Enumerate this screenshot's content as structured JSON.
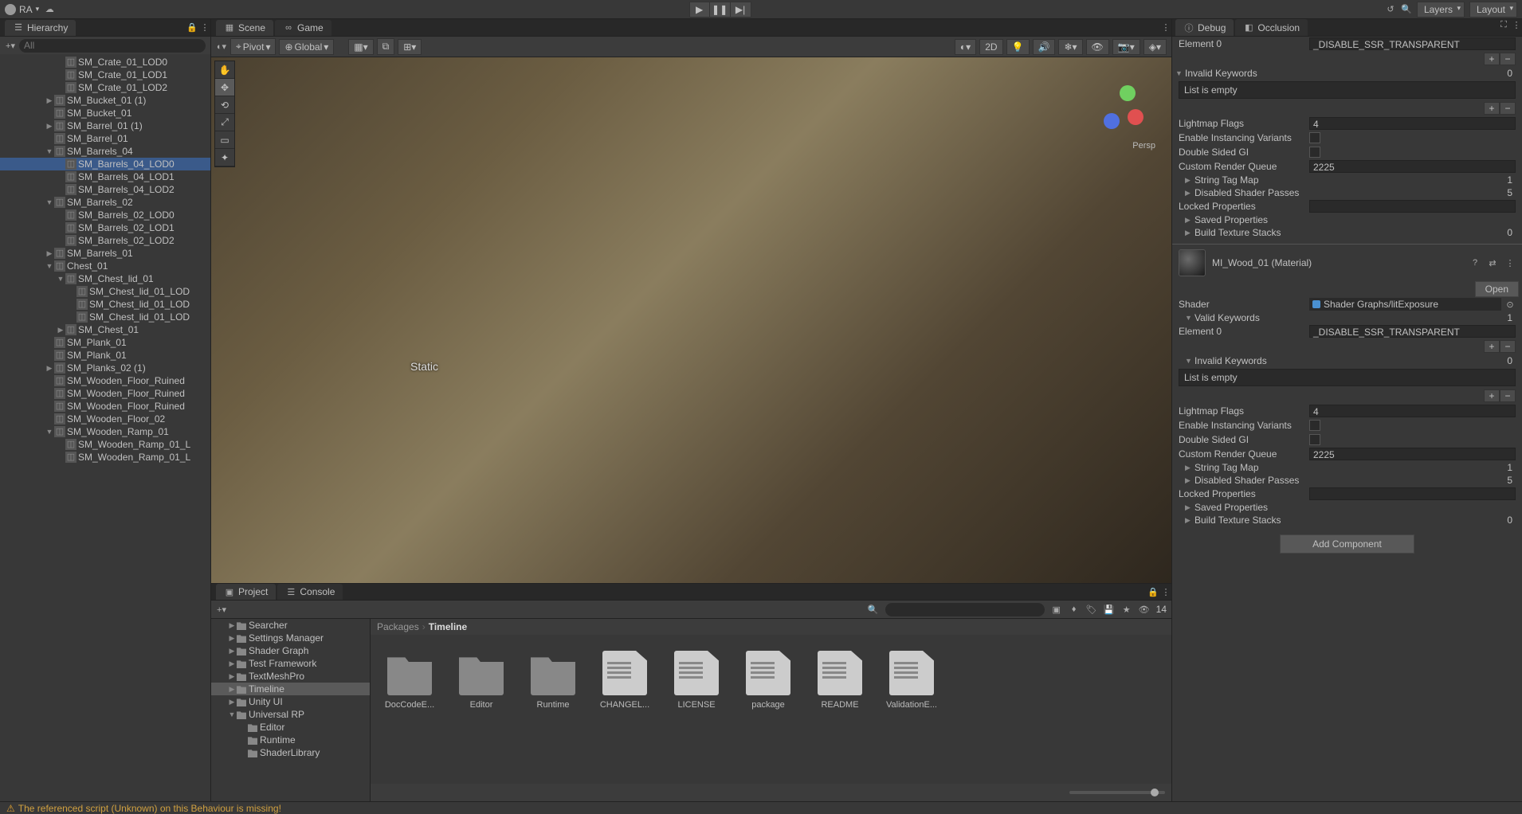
{
  "topbar": {
    "account": "RA",
    "layers": "Layers",
    "layout": "Layout"
  },
  "tabs": {
    "hierarchy": "Hierarchy",
    "scene": "Scene",
    "game": "Game",
    "project": "Project",
    "console": "Console",
    "debug": "Debug",
    "occlusion": "Occlusion"
  },
  "sceneToolbar": {
    "pivot": "Pivot",
    "global": "Global",
    "twoD": "2D"
  },
  "hierarchy": {
    "search_placeholder": "All",
    "items": [
      {
        "name": "SM_Crate_01_LOD0",
        "depth": 5
      },
      {
        "name": "SM_Crate_01_LOD1",
        "depth": 5
      },
      {
        "name": "SM_Crate_01_LOD2",
        "depth": 5
      },
      {
        "name": "SM_Bucket_01 (1)",
        "depth": 4,
        "exp": true
      },
      {
        "name": "SM_Bucket_01",
        "depth": 4
      },
      {
        "name": "SM_Barrel_01 (1)",
        "depth": 4,
        "exp": true
      },
      {
        "name": "SM_Barrel_01",
        "depth": 4
      },
      {
        "name": "SM_Barrels_04",
        "depth": 4,
        "open": true
      },
      {
        "name": "SM_Barrels_04_LOD0",
        "depth": 5,
        "sel": true
      },
      {
        "name": "SM_Barrels_04_LOD1",
        "depth": 5
      },
      {
        "name": "SM_Barrels_04_LOD2",
        "depth": 5
      },
      {
        "name": "SM_Barrels_02",
        "depth": 4,
        "open": true
      },
      {
        "name": "SM_Barrels_02_LOD0",
        "depth": 5
      },
      {
        "name": "SM_Barrels_02_LOD1",
        "depth": 5
      },
      {
        "name": "SM_Barrels_02_LOD2",
        "depth": 5
      },
      {
        "name": "SM_Barrels_01",
        "depth": 4,
        "exp": true
      },
      {
        "name": "Chest_01",
        "depth": 4,
        "open": true
      },
      {
        "name": "SM_Chest_lid_01",
        "depth": 5,
        "open": true
      },
      {
        "name": "SM_Chest_lid_01_LOD",
        "depth": 6
      },
      {
        "name": "SM_Chest_lid_01_LOD",
        "depth": 6
      },
      {
        "name": "SM_Chest_lid_01_LOD",
        "depth": 6
      },
      {
        "name": "SM_Chest_01",
        "depth": 5,
        "exp": true
      },
      {
        "name": "SM_Plank_01",
        "depth": 4
      },
      {
        "name": "SM_Plank_01",
        "depth": 4
      },
      {
        "name": "SM_Planks_02 (1)",
        "depth": 4,
        "exp": true
      },
      {
        "name": "SM_Wooden_Floor_Ruined",
        "depth": 4
      },
      {
        "name": "SM_Wooden_Floor_Ruined",
        "depth": 4
      },
      {
        "name": "SM_Wooden_Floor_Ruined",
        "depth": 4
      },
      {
        "name": "SM_Wooden_Floor_02",
        "depth": 4
      },
      {
        "name": "SM_Wooden_Ramp_01",
        "depth": 4,
        "open": true
      },
      {
        "name": "SM_Wooden_Ramp_01_L",
        "depth": 5
      },
      {
        "name": "SM_Wooden_Ramp_01_L",
        "depth": 5
      }
    ]
  },
  "scene": {
    "static_label": "Static",
    "persp": "Persp"
  },
  "projectTree": [
    {
      "name": "Searcher",
      "depth": 1,
      "exp": true
    },
    {
      "name": "Settings Manager",
      "depth": 1,
      "exp": true
    },
    {
      "name": "Shader Graph",
      "depth": 1,
      "exp": true
    },
    {
      "name": "Test Framework",
      "depth": 1,
      "exp": true
    },
    {
      "name": "TextMeshPro",
      "depth": 1,
      "exp": true
    },
    {
      "name": "Timeline",
      "depth": 1,
      "exp": true,
      "sel": true
    },
    {
      "name": "Unity UI",
      "depth": 1,
      "exp": true
    },
    {
      "name": "Universal RP",
      "depth": 1,
      "open": true
    },
    {
      "name": "Editor",
      "depth": 2
    },
    {
      "name": "Runtime",
      "depth": 2
    },
    {
      "name": "ShaderLibrary",
      "depth": 2
    }
  ],
  "breadcrumb": {
    "root": "Packages",
    "current": "Timeline"
  },
  "projectGrid": [
    {
      "name": "DocCodeE...",
      "type": "folder"
    },
    {
      "name": "Editor",
      "type": "folder"
    },
    {
      "name": "Runtime",
      "type": "folder"
    },
    {
      "name": "CHANGEL...",
      "type": "file"
    },
    {
      "name": "LICENSE",
      "type": "file"
    },
    {
      "name": "package",
      "type": "file"
    },
    {
      "name": "README",
      "type": "file"
    },
    {
      "name": "ValidationE...",
      "type": "file"
    }
  ],
  "inspector": {
    "element0": "Element 0",
    "disable_ssr": "_DISABLE_SSR_TRANSPARENT",
    "invalid_keywords": "Invalid Keywords",
    "invalid_count": "0",
    "list_empty": "List is empty",
    "lightmap_flags": "Lightmap Flags",
    "lightmap_val": "4",
    "enable_inst": "Enable Instancing Variants",
    "double_gi": "Double Sided GI",
    "custom_queue": "Custom Render Queue",
    "custom_queue_val": "2225",
    "string_tag": "String Tag Map",
    "string_tag_val": "1",
    "disabled_passes": "Disabled Shader Passes",
    "disabled_passes_val": "5",
    "locked_props": "Locked Properties",
    "saved_props": "Saved Properties",
    "build_tex": "Build Texture Stacks",
    "build_tex_val": "0",
    "material_name": "MI_Wood_01 (Material)",
    "open": "Open",
    "shader": "Shader",
    "shader_val": "Shader Graphs/litExposure",
    "valid_keywords": "Valid Keywords",
    "valid_count": "1",
    "add_component": "Add Component"
  },
  "projToolbar": {
    "count": "14"
  },
  "status": {
    "warning": "The referenced script (Unknown) on this Behaviour is missing!"
  }
}
